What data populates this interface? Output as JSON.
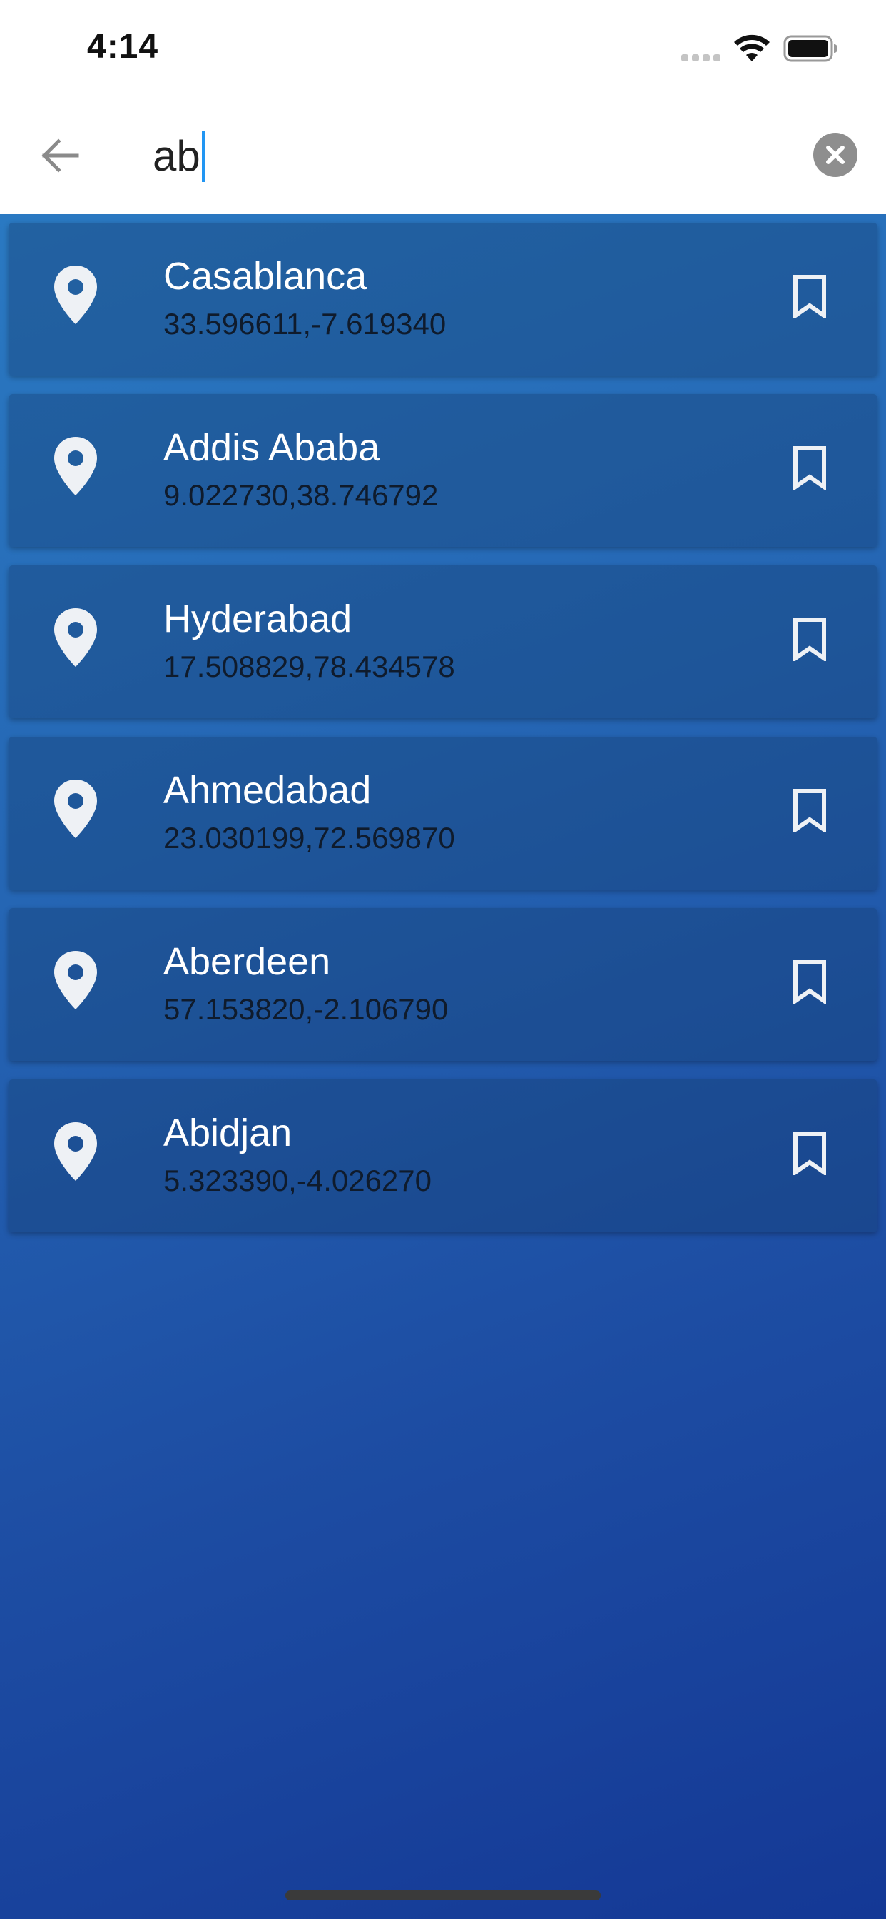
{
  "status_bar": {
    "time": "4:14"
  },
  "search": {
    "value": "ab",
    "back_icon": "arrow-left-icon",
    "clear_icon": "close-circle-icon"
  },
  "results": [
    {
      "name": "Casablanca",
      "coords": "33.596611,-7.619340"
    },
    {
      "name": "Addis Ababa",
      "coords": "9.022730,38.746792"
    },
    {
      "name": "Hyderabad",
      "coords": "17.508829,78.434578"
    },
    {
      "name": "Ahmedabad",
      "coords": "23.030199,72.569870"
    },
    {
      "name": "Aberdeen",
      "coords": "57.153820,-2.106790"
    },
    {
      "name": "Abidjan",
      "coords": "5.323390,-4.026270"
    }
  ],
  "colors": {
    "accent": "#2196f3",
    "background_top": "#2c7fc6",
    "background_bottom": "#143895"
  }
}
